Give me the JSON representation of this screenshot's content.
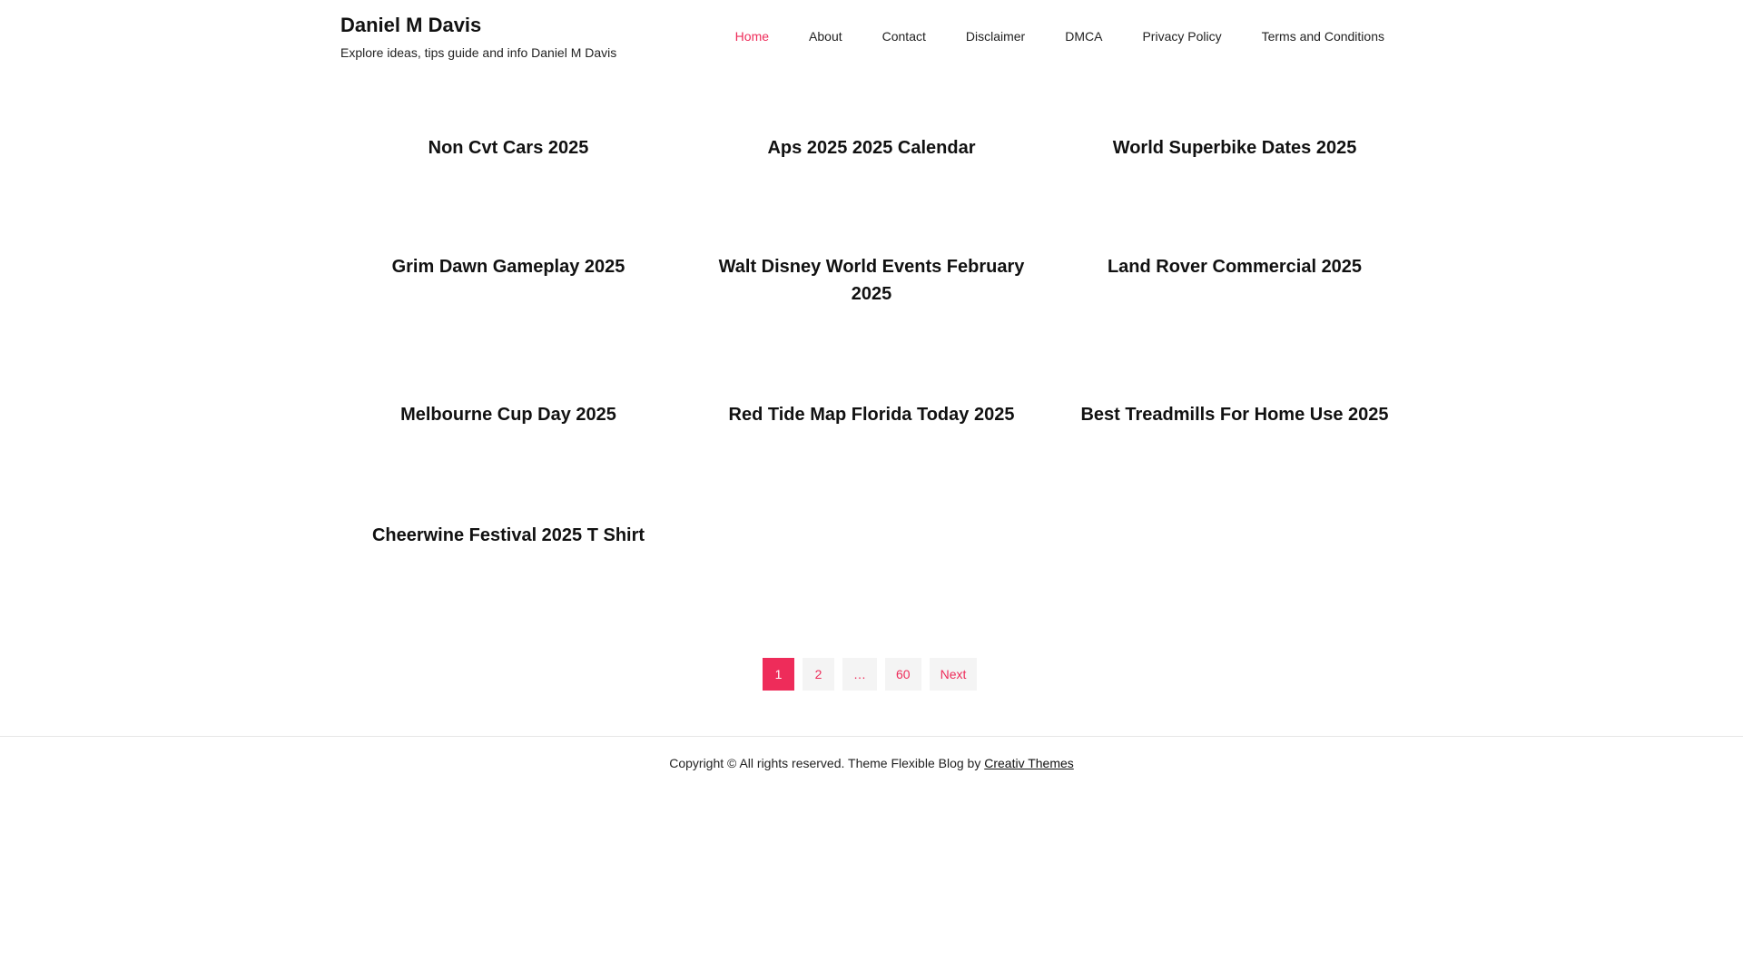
{
  "header": {
    "site_title": "Daniel M Davis",
    "tagline": "Explore ideas, tips guide and info Daniel M Davis"
  },
  "nav": {
    "items": [
      {
        "label": "Home",
        "active": true
      },
      {
        "label": "About"
      },
      {
        "label": "Contact"
      },
      {
        "label": "Disclaimer"
      },
      {
        "label": "DMCA"
      },
      {
        "label": "Privacy Policy"
      },
      {
        "label": "Terms and Conditions"
      }
    ]
  },
  "posts": [
    "Non Cvt Cars 2025",
    "Aps 2025 2025 Calendar",
    "World Superbike Dates 2025",
    "Grim Dawn Gameplay 2025",
    "Walt Disney World Events February 2025",
    "Land Rover Commercial 2025",
    "Melbourne Cup Day 2025",
    "Red Tide Map Florida Today 2025",
    "Best Treadmills For Home Use 2025",
    "Cheerwine Festival 2025 T Shirt"
  ],
  "pagination": {
    "pages": [
      "1",
      "2",
      "…",
      "60"
    ],
    "current": "1",
    "next_label": "Next"
  },
  "footer": {
    "text": "Copyright © All rights reserved. Theme Flexible Blog by ",
    "link_label": "Creativ Themes"
  },
  "colors": {
    "accent": "#ee2c5a",
    "pagination_bg": "#f4f4f4"
  }
}
